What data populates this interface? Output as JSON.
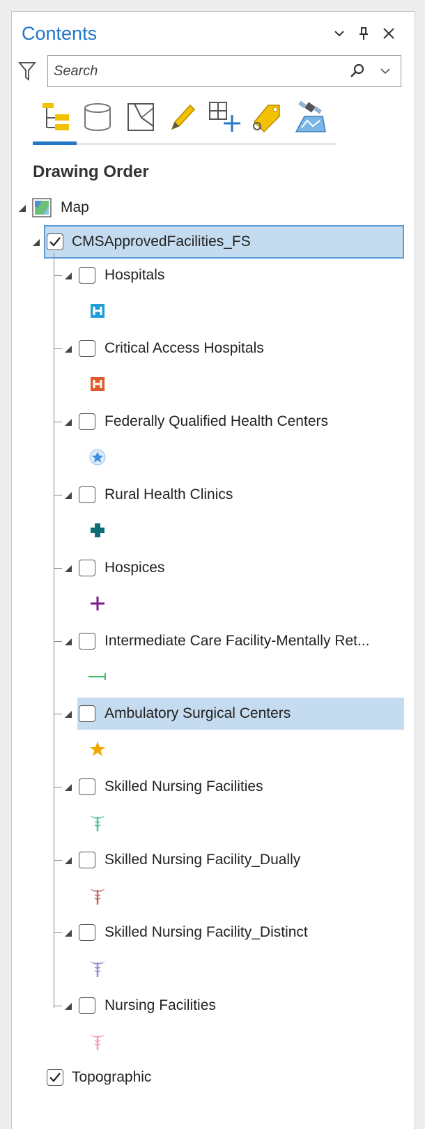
{
  "panel": {
    "title": "Contents",
    "title_buttons": [
      "chevron-down-icon",
      "pin-icon",
      "close-icon"
    ]
  },
  "search": {
    "placeholder": "Search",
    "value": ""
  },
  "toolbar": {
    "tools": [
      "drawing-order-icon",
      "data-source-icon",
      "selection-icon",
      "editing-icon",
      "snapping-icon",
      "labeling-icon",
      "perspective-imagery-icon"
    ],
    "active_index": 0
  },
  "section_title": "Drawing Order",
  "tree": {
    "map_label": "Map",
    "service_label": "CMSApprovedFacilities_FS",
    "layers": [
      {
        "label": "Hospitals",
        "symbol": "hospital-blue-h-icon",
        "color": "#1f9fd6"
      },
      {
        "label": "Critical Access Hospitals",
        "symbol": "hospital-orange-h-icon",
        "color": "#e2592b"
      },
      {
        "label": "Federally Qualified Health Centers",
        "symbol": "blue-star-circle-icon",
        "color": "#3b8fe0"
      },
      {
        "label": "Rural Health Clinics",
        "symbol": "teal-cross-icon",
        "color": "#0f6b74"
      },
      {
        "label": "Hospices",
        "symbol": "purple-plus-icon",
        "color": "#7a1a8a"
      },
      {
        "label": "Intermediate Care Facility-Mentally Ret...",
        "symbol": "green-line-icon",
        "color": "#3dbb6a"
      },
      {
        "label": "Ambulatory Surgical Centers",
        "symbol": "gold-star-icon",
        "color": "#f0a800"
      },
      {
        "label": "Skilled Nursing Facilities",
        "symbol": "green-caduceus-icon",
        "color": "#49c48e"
      },
      {
        "label": "Skilled Nursing Facility_Dually",
        "symbol": "brown-caduceus-icon",
        "color": "#b86a5c"
      },
      {
        "label": "Skilled Nursing Facility_Distinct",
        "symbol": "lavender-caduceus-icon",
        "color": "#9a86cf"
      },
      {
        "label": "Nursing Facilities",
        "symbol": "pink-caduceus-icon",
        "color": "#f09bb4"
      }
    ],
    "basemap_label": "Topographic"
  },
  "colors": {
    "accent": "#2277c7",
    "selection": "#c5dbef",
    "selection_border": "#5a9bd6"
  }
}
